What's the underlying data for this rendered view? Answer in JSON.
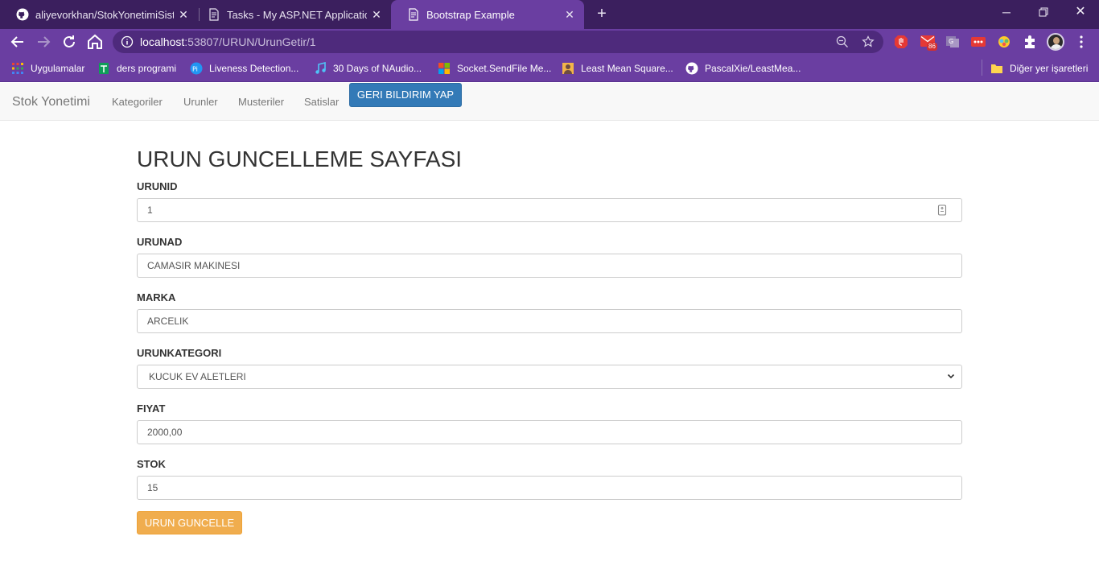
{
  "browser": {
    "tabs": [
      {
        "title": "aliyevorkhan/StokYonetimiSistem"
      },
      {
        "title": "Tasks - My ASP.NET Application"
      },
      {
        "title": "Bootstrap Example"
      }
    ],
    "url_host": "localhost",
    "url_rest": ":53807/URUN/UrunGetir/1",
    "mail_badge": "86",
    "bookmarks": [
      {
        "label": "Uygulamalar"
      },
      {
        "label": "ders programi"
      },
      {
        "label": "Liveness Detection..."
      },
      {
        "label": "30 Days of NAudio..."
      },
      {
        "label": "Socket.SendFile Me..."
      },
      {
        "label": "Least Mean Square..."
      },
      {
        "label": "PascalXie/LeastMea..."
      }
    ],
    "other_bookmarks": "Diğer yer işaretleri"
  },
  "navbar": {
    "brand": "Stok Yonetimi",
    "links": [
      "Kategoriler",
      "Urunler",
      "Musteriler",
      "Satislar"
    ],
    "feedback_button": "GERI BILDIRIM YAP"
  },
  "form": {
    "title": "URUN GUNCELLEME SAYFASI",
    "fields": {
      "urunid": {
        "label": "URUNID",
        "value": "1"
      },
      "urunad": {
        "label": "URUNAD",
        "value": "CAMASIR MAKINESI"
      },
      "marka": {
        "label": "MARKA",
        "value": "ARCELIK"
      },
      "kategori": {
        "label": "URUNKATEGORI",
        "selected": "KUCUK EV ALETLERI"
      },
      "fiyat": {
        "label": "FIYAT",
        "value": "2000,00"
      },
      "stok": {
        "label": "STOK",
        "value": "15"
      }
    },
    "submit_button": "URUN GUNCELLE"
  },
  "colors": {
    "tabstrip": "#3b1f5e",
    "toolbar": "#6a3ea1",
    "primary_button": "#337ab7",
    "warning_button": "#f0ad4e"
  }
}
